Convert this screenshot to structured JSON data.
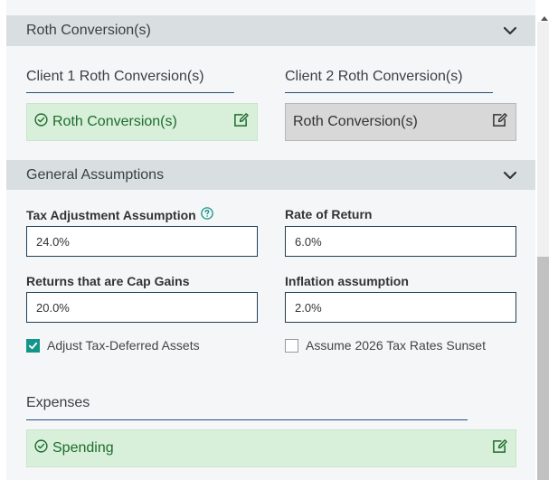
{
  "roth": {
    "header": "Roth Conversion(s)",
    "client1_title": "Client 1 Roth Conversion(s)",
    "client2_title": "Client 2 Roth Conversion(s)",
    "client1_box": "Roth Conversion(s)",
    "client2_box": "Roth Conversion(s)"
  },
  "assumptions": {
    "header": "General Assumptions",
    "tax_adjustment_label": "Tax Adjustment Assumption",
    "tax_adjustment_value": "24.0%",
    "rate_of_return_label": "Rate of Return",
    "rate_of_return_value": "6.0%",
    "cap_gains_label": "Returns that are Cap Gains",
    "cap_gains_value": "20.0%",
    "inflation_label": "Inflation assumption",
    "inflation_value": "2.0%",
    "adjust_tax_deferred_label": "Adjust Tax-Deferred Assets",
    "adjust_tax_deferred_checked": true,
    "sunset_label": "Assume 2026 Tax Rates Sunset",
    "sunset_checked": false
  },
  "expenses": {
    "title": "Expenses",
    "spending_box": "Spending"
  },
  "colors": {
    "accent_teal": "#12968a",
    "success_green": "#1f6b2e",
    "success_bg": "#d8f0da",
    "header_bg": "#d9dee1",
    "rule_blue": "#23527c"
  },
  "icons": {
    "chevron": "chevron-down-icon",
    "edit": "edit-icon",
    "check_circle": "check-circle-icon",
    "help": "help-icon"
  }
}
